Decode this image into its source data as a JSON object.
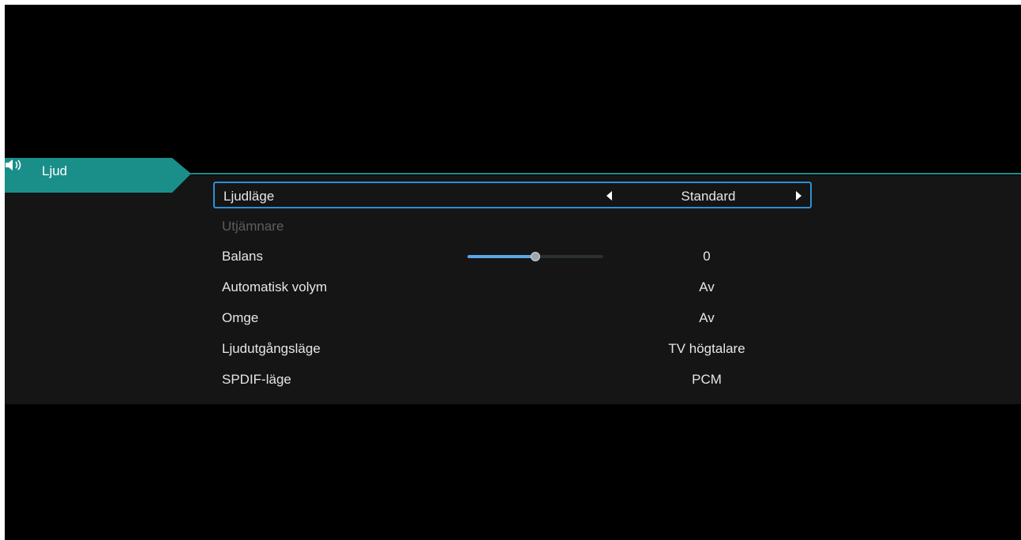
{
  "menu": {
    "tab_label": "Ljud",
    "tab_icon": "speaker-icon",
    "accent_color": "#1a8f8a",
    "selection_color": "#2f8fd6"
  },
  "settings": [
    {
      "label": "Ljudläge",
      "value": "Standard"
    },
    {
      "label": "Utjämnare",
      "value": ""
    },
    {
      "label": "Balans",
      "value": "0",
      "slider_fraction": 0.5
    },
    {
      "label": "Automatisk volym",
      "value": "Av"
    },
    {
      "label": "Omge",
      "value": "Av"
    },
    {
      "label": "Ljudutgångsläge",
      "value": "TV högtalare"
    },
    {
      "label": "SPDIF-läge",
      "value": "PCM"
    }
  ]
}
